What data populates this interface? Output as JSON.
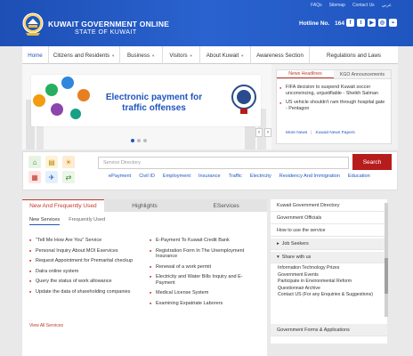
{
  "header": {
    "top_links": [
      "FAQs",
      "Sitemap",
      "Contact Us",
      "عربي"
    ],
    "title": "KUWAIT GOVERNMENT ONLINE",
    "subtitle": "STATE OF KUWAIT",
    "hotline_label": "Hotline No.",
    "hotline_number": "164",
    "social_icons": [
      "facebook-icon",
      "twitter-icon",
      "youtube-icon",
      "instagram-icon",
      "rss-icon"
    ],
    "colors": {
      "brand_blue": "#1f55bf",
      "accent_red": "#b71c1c"
    }
  },
  "nav": {
    "items": [
      {
        "label": "Home",
        "dropdown": false
      },
      {
        "label": "Citizens and Residents",
        "dropdown": true
      },
      {
        "label": "Business",
        "dropdown": true
      },
      {
        "label": "Visitors",
        "dropdown": true
      },
      {
        "label": "About Kuwait",
        "dropdown": true
      },
      {
        "label": "Awareness Section",
        "dropdown": false
      },
      {
        "label": "Regulations and Laws",
        "dropdown": false
      }
    ]
  },
  "banner": {
    "headline": "Electronic payment for traffic offenses"
  },
  "news": {
    "tabs": [
      "News Headlines",
      "KGO Announcements"
    ],
    "items": [
      "FIFA decision to suspend Kuwait soccer unconvincing, unjustifiable - Sheikh Salman",
      "US vehicle shouldn't ram through hospital gate - Pentagon"
    ],
    "links": [
      "More News",
      "Kuwait News Papers"
    ]
  },
  "search": {
    "placeholder": "Service Directory",
    "button": "Search",
    "tags": [
      "ePayment",
      "Civil ID",
      "Employment",
      "Insurance",
      "Traffic",
      "Electricity",
      "Residency And Immigration",
      "Education"
    ]
  },
  "services": {
    "tabs": [
      "New And Frequently Used",
      "Highlights",
      "EServices"
    ],
    "sub_tabs": [
      "New Services",
      "Frequently Used"
    ],
    "left": [
      "\"Tell Me How Are You\" Service",
      "Personal Inquiry About MOI Eservices",
      "Request Appointment for Premarital checkup",
      "Dalra online system",
      "Query the status of work allowance",
      "Update the data of shareholding companies"
    ],
    "right": [
      "E-Payment To Kuwait Credit Bank",
      "Registration Form In The Unemployment Insurance",
      "Renewal of a work permit",
      "Electricity and Water Bills Inquiry and E-Payment",
      "Medical License System",
      "Examining Expatriate Laborers"
    ],
    "view_all": "View All Services"
  },
  "sidebar": {
    "items": [
      "Kuwait Government Directory",
      "Government Officials",
      "How to use the service",
      "Job Seekers",
      "Share with us",
      "Government Forms & Applications"
    ],
    "share_sub": [
      "Information Technology Prizes",
      "Government Events",
      "Participate in Environmental Reform",
      "Questionnair Archive",
      "Contact US (For any Enquiries & Suggestions)"
    ]
  }
}
